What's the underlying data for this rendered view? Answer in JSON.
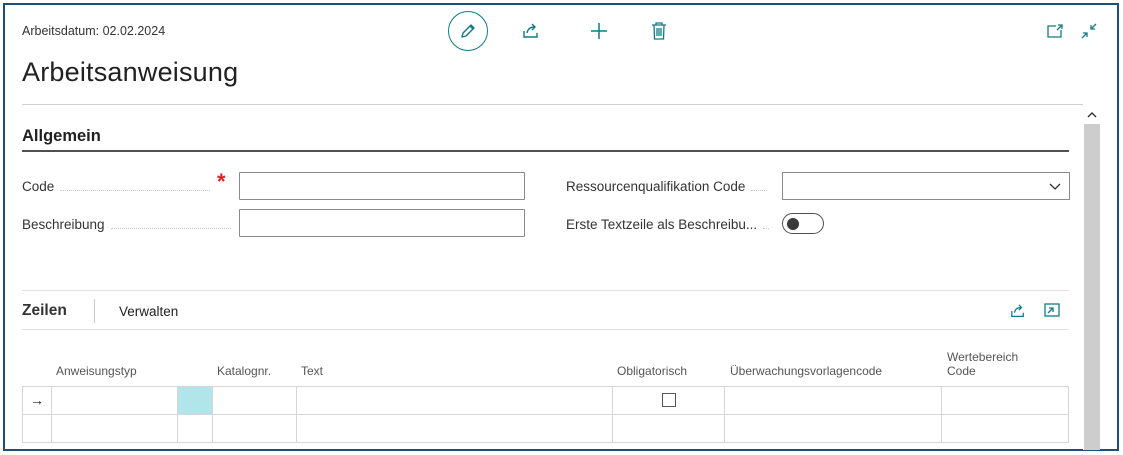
{
  "header": {
    "date_line": "Arbeitsdatum: 02.02.2024",
    "title": "Arbeitsanweisung"
  },
  "toolbar": {
    "edit_icon": "pencil-icon",
    "share_icon": "share-icon",
    "new_icon": "plus-icon",
    "delete_icon": "trash-icon",
    "popout_icon": "open-in-new-window-icon",
    "collapse_icon": "collapse-icon"
  },
  "section": {
    "title": "Allgemein",
    "fields": {
      "code": {
        "label": "Code",
        "value": "",
        "required": true
      },
      "beschreibung": {
        "label": "Beschreibung",
        "value": ""
      },
      "ressourcenqualifikation": {
        "label": "Ressourcenqualifikation Code",
        "value": ""
      },
      "erste_textzeile": {
        "label": "Erste Textzeile als Beschreibu...",
        "value": false
      }
    }
  },
  "lines": {
    "title": "Zeilen",
    "manage_label": "Verwalten",
    "columns": {
      "anweisungstyp": "Anweisungstyp",
      "katalognr": "Katalognr.",
      "text": "Text",
      "obligatorisch": "Obligatorisch",
      "ueberwachung": "Überwachungsvorlagencode",
      "wertebereich_1": "Wertebereich",
      "wertebereich_2": "Code"
    },
    "rows": [
      {
        "indicator": "→",
        "anweisungstyp": "",
        "katalognr": "",
        "text": "",
        "obligatorisch": false,
        "ueberwachung": "",
        "wertebereich": ""
      },
      {
        "indicator": "",
        "anweisungstyp": "",
        "katalognr": "",
        "text": "",
        "obligatorisch": null,
        "ueberwachung": "",
        "wertebereich": ""
      }
    ]
  },
  "colors": {
    "accent": "#0e7c86",
    "required": "#e0201e",
    "active_cell": "#b1e5ea",
    "frame": "#1f4e79"
  }
}
